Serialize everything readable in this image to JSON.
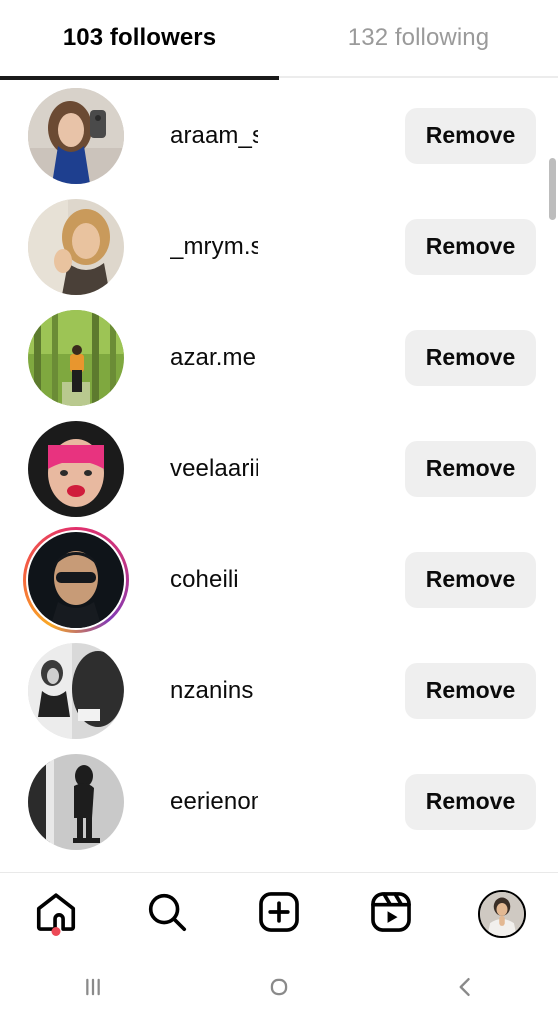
{
  "tabs": [
    {
      "label": "103 followers",
      "active": true,
      "name": "tab-followers"
    },
    {
      "label": "132 following",
      "active": false,
      "name": "tab-following"
    }
  ],
  "list": {
    "button_label": "Remove",
    "rows": [
      {
        "username": "araam_s",
        "has_story_ring": false,
        "avatar": "woman-mirror-selfie-blue-top"
      },
      {
        "username": "_mrym.s",
        "has_story_ring": false,
        "avatar": "blonde-woman-portrait"
      },
      {
        "username": "azar.me",
        "has_story_ring": false,
        "avatar": "person-in-green-forest"
      },
      {
        "username": "veelaarii",
        "has_story_ring": false,
        "avatar": "pink-hair-woman-portrait"
      },
      {
        "username": "coheili",
        "has_story_ring": true,
        "avatar": "person-dark-sunglasses"
      },
      {
        "username": "nzanins",
        "has_story_ring": false,
        "avatar": "bw-woman-long-hair"
      },
      {
        "username": "eerienom",
        "has_story_ring": false,
        "avatar": "bw-walking-figure"
      }
    ]
  },
  "bottom_nav": {
    "items": [
      {
        "icon": "home-icon",
        "name": "nav-home",
        "badge": true
      },
      {
        "icon": "search-icon",
        "name": "nav-search",
        "badge": false
      },
      {
        "icon": "create-icon",
        "name": "nav-create",
        "badge": false
      },
      {
        "icon": "reels-icon",
        "name": "nav-reels",
        "badge": false
      },
      {
        "icon": "avatar-icon",
        "name": "nav-profile",
        "badge": false
      }
    ]
  },
  "system_bar": {
    "items": [
      {
        "icon": "recents-icon",
        "name": "sysnav-recents"
      },
      {
        "icon": "home-circle-icon",
        "name": "sysnav-home"
      },
      {
        "icon": "back-chevron-icon",
        "name": "sysnav-back"
      }
    ]
  },
  "colors": {
    "accent_badge": "#ed4956",
    "button_bg": "#efefef",
    "active_tab": "#000000",
    "inactive_tab": "#9a9a9a",
    "scrollbar": "#bdbdbd"
  }
}
